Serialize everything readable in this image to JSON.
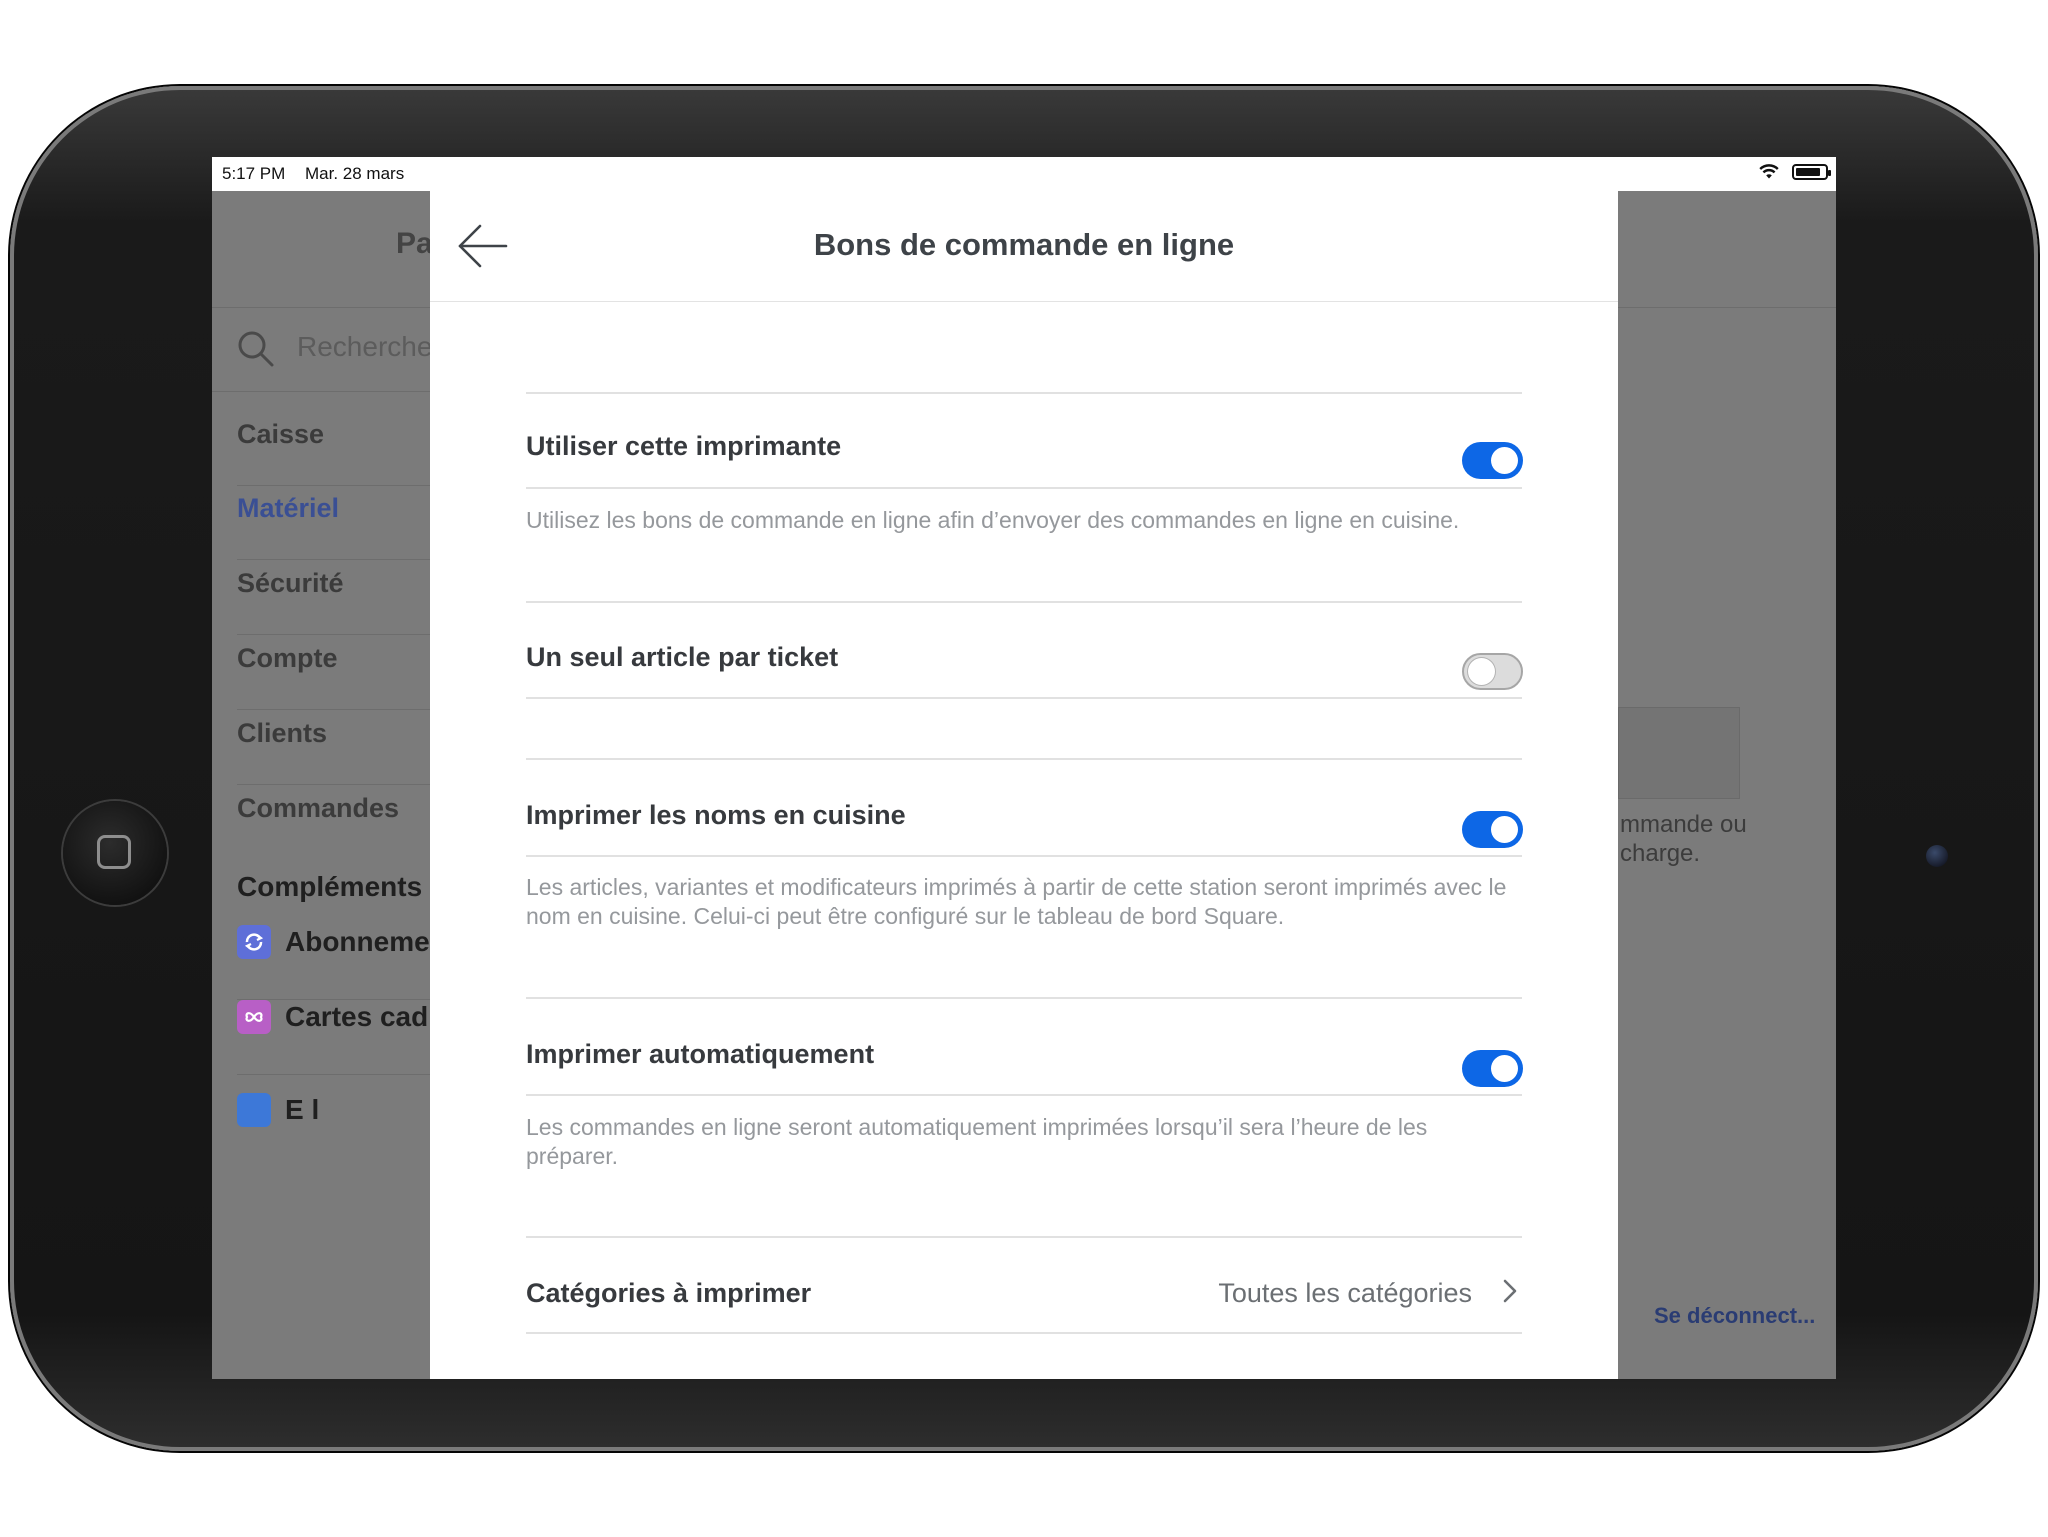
{
  "status_bar": {
    "time": "5:17 PM",
    "date": "Mar. 28 mars"
  },
  "sidebar": {
    "title": "Pa",
    "search_placeholder": "Recherche",
    "items": [
      {
        "label": "Caisse",
        "active": false
      },
      {
        "label": "Matériel",
        "active": true
      },
      {
        "label": "Sécurité",
        "active": false
      },
      {
        "label": "Compte",
        "active": false
      },
      {
        "label": "Clients",
        "active": false
      },
      {
        "label": "Commandes",
        "active": false
      }
    ],
    "section_title": "Compléments",
    "addons": [
      {
        "label": "Abonnemen",
        "icon": "sync-icon",
        "color": "#5e6fd8"
      },
      {
        "label": "Cartes cad",
        "icon": "gift-icon",
        "color": "#b85fc6"
      },
      {
        "label": "E l",
        "icon": "mail-icon",
        "color": "#3d78d8"
      }
    ]
  },
  "background_pane": {
    "text_line_1": "mmande ou",
    "text_line_2": "charge.",
    "logout_label": "Se déconnect..."
  },
  "modal": {
    "title": "Bons de commande en ligne",
    "settings": [
      {
        "label": "Utiliser cette imprimante",
        "enabled": true,
        "description": "Utilisez les bons de commande en ligne afin d’envoyer des commandes en ligne en cuisine."
      },
      {
        "label": "Un seul article par ticket",
        "enabled": false,
        "description": ""
      },
      {
        "label": "Imprimer les noms en cuisine",
        "enabled": true,
        "description": "Les articles, variantes et modificateurs imprimés à partir de cette station seront imprimés avec le nom en cuisine. Celui-ci peut être configuré sur le tableau de bord Square."
      },
      {
        "label": "Imprimer automatiquement",
        "enabled": true,
        "description": "Les commandes en ligne seront automatiquement imprimées lorsqu’il sera l’heure de les préparer."
      }
    ],
    "categories": {
      "label": "Catégories à imprimer",
      "value": "Toutes les catégories"
    }
  },
  "colors": {
    "accent": "#0d67e6",
    "sidebar_active": "#3a4f94",
    "overlay": "#7b7b7b"
  }
}
